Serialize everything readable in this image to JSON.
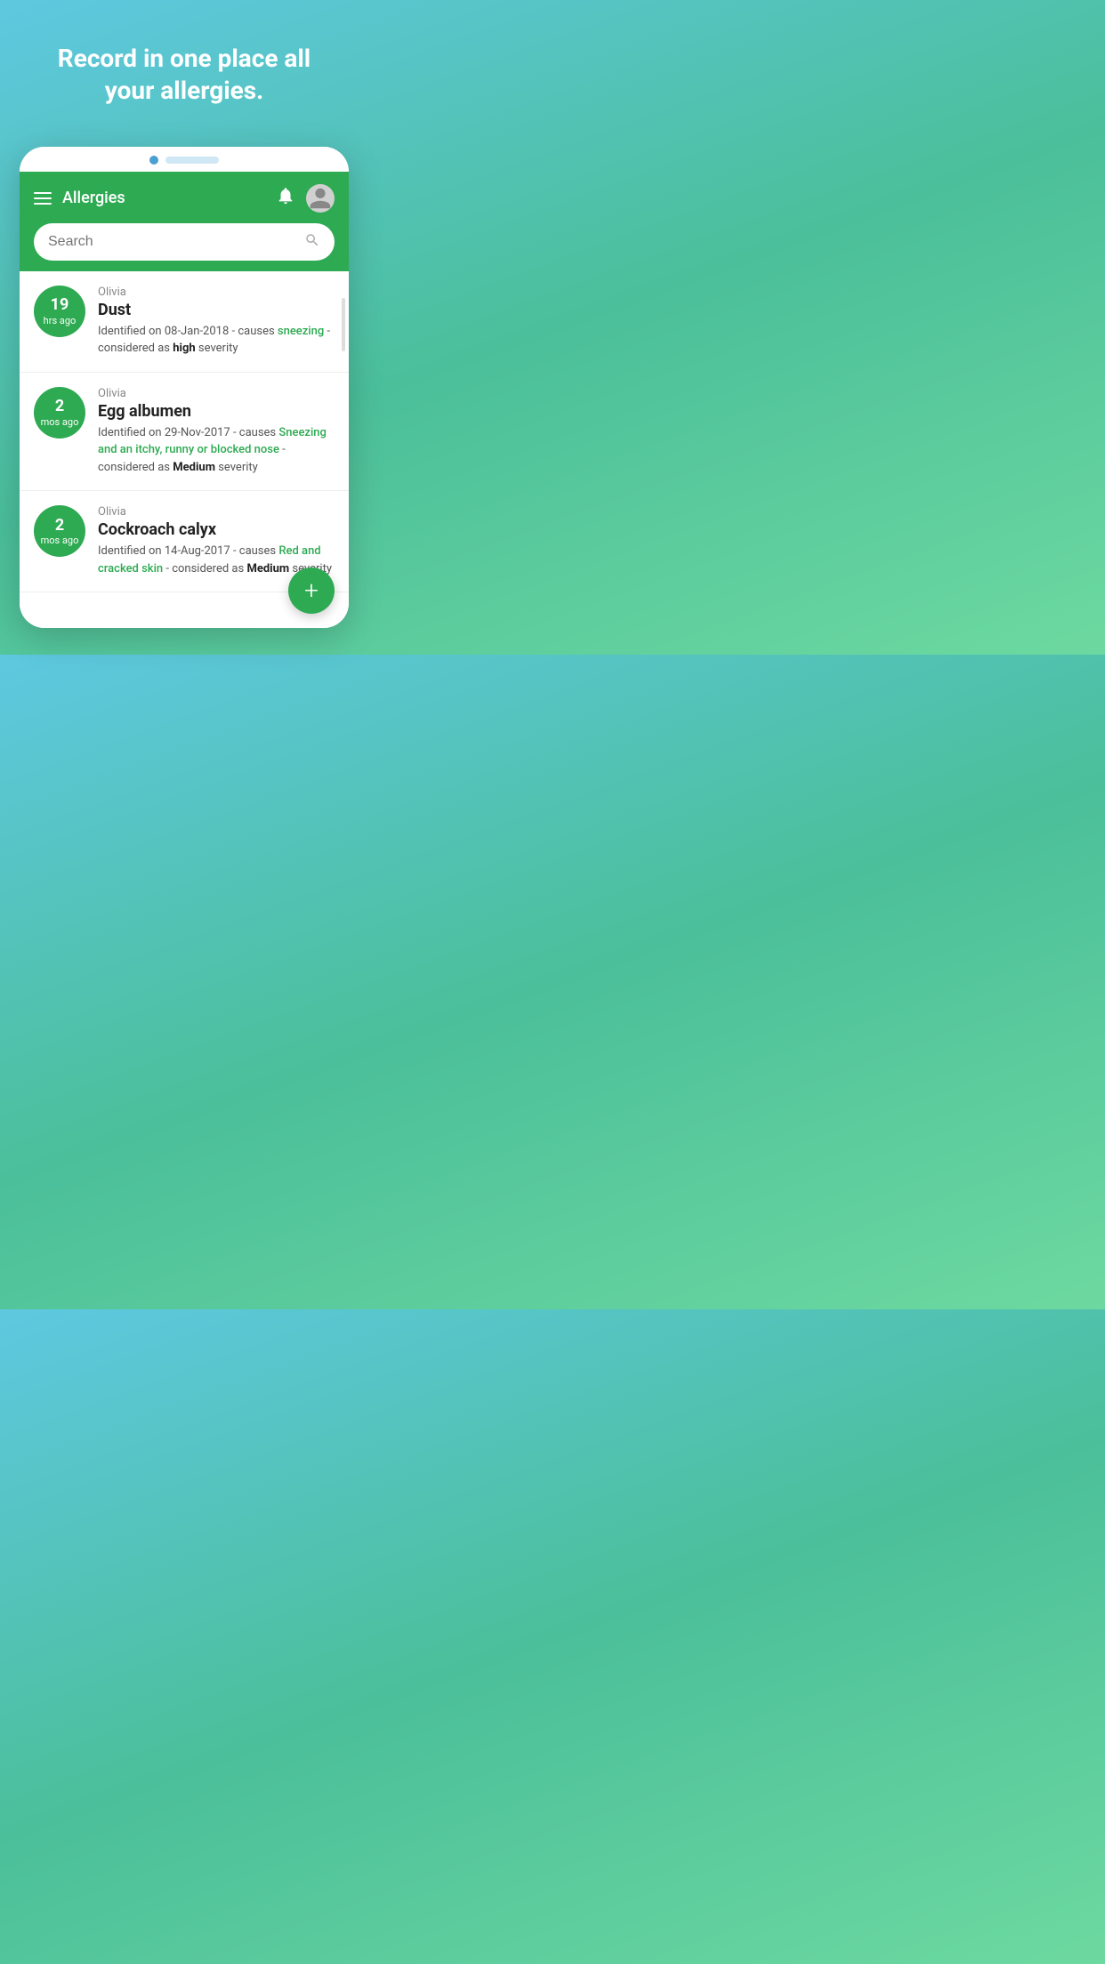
{
  "hero": {
    "text": "Record in one place all your allergies."
  },
  "header": {
    "title": "Allergies",
    "search_placeholder": "Search"
  },
  "allergies": [
    {
      "person": "Olivia",
      "time_num": "19",
      "time_unit": "hrs ago",
      "name": "Dust",
      "identified": "Identified on 08-Jan-2018 - causes",
      "cause": "sneezing",
      "considered": "- considered as",
      "severity": "high",
      "severity_suffix": "severity"
    },
    {
      "person": "Olivia",
      "time_num": "2",
      "time_unit": "mos ago",
      "name": "Egg albumen",
      "identified": "Identified on 29-Nov-2017 - causes",
      "cause": "Sneezing and an itchy, runny or blocked nose",
      "considered": "- considered as",
      "severity": "Medium",
      "severity_suffix": "severity"
    },
    {
      "person": "Olivia",
      "time_num": "2",
      "time_unit": "mos ago",
      "name": "Cockroach calyx",
      "identified": "Identified on 14-Aug-2017 - causes",
      "cause": "Red and cracked skin",
      "considered": "- considered as",
      "severity": "Medium",
      "severity_suffix": "severity"
    }
  ],
  "fab_label": "+"
}
